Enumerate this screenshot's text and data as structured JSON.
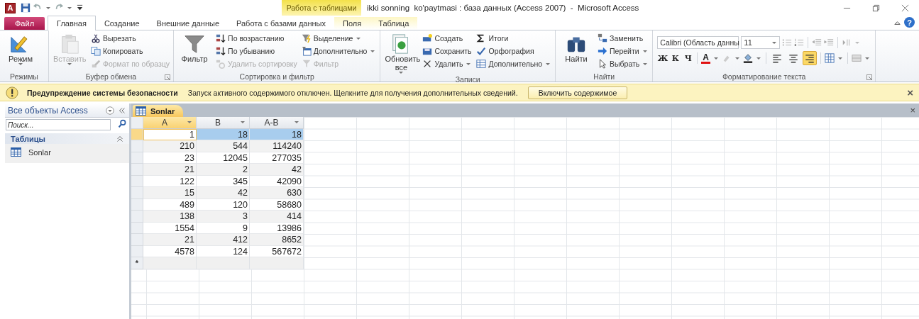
{
  "title_bar": {
    "app_letter": "A",
    "contextual_label": "Работа с таблицами",
    "title": "ikki sonning  ko'paytmasi : база данных (Access 2007)  -  Microsoft Access"
  },
  "tabs": [
    {
      "label": "Файл",
      "kind": "file",
      "selected": false
    },
    {
      "label": "Главная",
      "kind": "normal",
      "selected": true
    },
    {
      "label": "Создание",
      "kind": "normal",
      "selected": false
    },
    {
      "label": "Внешние данные",
      "kind": "normal",
      "selected": false
    },
    {
      "label": "Работа с базами данных",
      "kind": "normal",
      "selected": false
    },
    {
      "label": "Поля",
      "kind": "contextual",
      "selected": false
    },
    {
      "label": "Таблица",
      "kind": "contextual",
      "selected": false
    }
  ],
  "help": "?",
  "ribbon": {
    "groups": [
      {
        "label": "Режимы",
        "kind": "buttons",
        "launcher": false,
        "columns": [
          {
            "kind": "large",
            "label": "Режим",
            "dropdown": true,
            "disabled": false
          }
        ]
      },
      {
        "label": "Буфер обмена",
        "kind": "buttons",
        "launcher": true,
        "columns": [
          {
            "kind": "large",
            "label": "Вставить",
            "dropdown": true,
            "disabled": true
          },
          {
            "kind": "stack",
            "items": [
              {
                "label": "Вырезать",
                "disabled": false,
                "dropdown": false
              },
              {
                "label": "Копировать",
                "disabled": false,
                "dropdown": false
              },
              {
                "label": "Формат по образцу",
                "disabled": true,
                "dropdown": false
              }
            ]
          }
        ]
      },
      {
        "label": "Сортировка и фильтр",
        "kind": "buttons",
        "launcher": false,
        "columns": [
          {
            "kind": "large",
            "label": "Фильтр",
            "dropdown": false,
            "disabled": false
          },
          {
            "kind": "stack",
            "items": [
              {
                "label": "По возрастанию",
                "disabled": false,
                "dropdown": false
              },
              {
                "label": "По убыванию",
                "disabled": false,
                "dropdown": false
              },
              {
                "label": "Удалить сортировку",
                "disabled": true,
                "dropdown": false
              }
            ]
          },
          {
            "kind": "stack",
            "items": [
              {
                "label": "Выделение",
                "disabled": false,
                "dropdown": true
              },
              {
                "label": "Дополнительно",
                "disabled": false,
                "dropdown": true
              },
              {
                "label": "Фильтр",
                "disabled": true,
                "dropdown": false
              }
            ]
          }
        ]
      },
      {
        "label": "Записи",
        "kind": "buttons",
        "launcher": false,
        "columns": [
          {
            "kind": "large",
            "label": "Обновить все",
            "dropdown": true,
            "disabled": false
          },
          {
            "kind": "stack",
            "items": [
              {
                "label": "Создать",
                "disabled": false,
                "dropdown": false
              },
              {
                "label": "Сохранить",
                "disabled": false,
                "dropdown": false
              },
              {
                "label": "Удалить",
                "disabled": false,
                "dropdown": true
              }
            ]
          },
          {
            "kind": "stack",
            "items": [
              {
                "label": "Итоги",
                "disabled": false,
                "dropdown": false
              },
              {
                "label": "Орфография",
                "disabled": false,
                "dropdown": false
              },
              {
                "label": "Дополнительно",
                "disabled": false,
                "dropdown": true
              }
            ]
          }
        ]
      },
      {
        "label": "Найти",
        "kind": "buttons",
        "launcher": false,
        "columns": [
          {
            "kind": "large",
            "label": "Найти",
            "dropdown": false,
            "disabled": false
          },
          {
            "kind": "stack",
            "items": [
              {
                "label": "Заменить",
                "disabled": false,
                "dropdown": false
              },
              {
                "label": "Перейти",
                "disabled": false,
                "dropdown": true
              },
              {
                "label": "Выбрать",
                "disabled": false,
                "dropdown": true
              }
            ]
          }
        ]
      },
      {
        "label": "Форматирование текста",
        "kind": "format",
        "launcher": true,
        "font": "Calibri (Область данны",
        "size": "11",
        "style_buttons": [
          "Ж",
          "К",
          "Ч"
        ],
        "font_color_label": "A",
        "align_buttons": [
          {
            "selected": false
          },
          {
            "selected": false
          },
          {
            "selected": true
          }
        ]
      }
    ]
  },
  "warning": {
    "title": "Предупреждение системы безопасности",
    "message": "Запуск активного содержимого отключен. Щелкните для получения дополнительных сведений.",
    "button": "Включить содержимое",
    "close": "×"
  },
  "nav": {
    "title": "Все объекты Access",
    "search": {
      "placeholder": "Поиск..."
    },
    "sections": [
      {
        "label": "Таблицы",
        "expanded": true,
        "items": [
          {
            "label": "Sonlar"
          }
        ]
      }
    ]
  },
  "document": {
    "tabs": [
      {
        "label": "Sonlar",
        "selected": true
      }
    ],
    "close": "×",
    "datasheet": {
      "columns": [
        {
          "label": "A",
          "selected": true
        },
        {
          "label": "B",
          "selected": false
        },
        {
          "label": "A-B",
          "selected": false
        }
      ],
      "rows": [
        {
          "selected": true,
          "cells": [
            "1",
            "18",
            "18"
          ]
        },
        {
          "selected": false,
          "cells": [
            "210",
            "544",
            "114240"
          ]
        },
        {
          "selected": false,
          "cells": [
            "23",
            "12045",
            "277035"
          ]
        },
        {
          "selected": false,
          "cells": [
            "21",
            "2",
            "42"
          ]
        },
        {
          "selected": false,
          "cells": [
            "122",
            "345",
            "42090"
          ]
        },
        {
          "selected": false,
          "cells": [
            "15",
            "42",
            "630"
          ]
        },
        {
          "selected": false,
          "cells": [
            "489",
            "120",
            "58680"
          ]
        },
        {
          "selected": false,
          "cells": [
            "138",
            "3",
            "414"
          ]
        },
        {
          "selected": false,
          "cells": [
            "1554",
            "9",
            "13986"
          ]
        },
        {
          "selected": false,
          "cells": [
            "21",
            "412",
            "8652"
          ]
        },
        {
          "selected": false,
          "cells": [
            "4578",
            "124",
            "567672"
          ]
        }
      ],
      "new_row_marker": "*"
    }
  }
}
